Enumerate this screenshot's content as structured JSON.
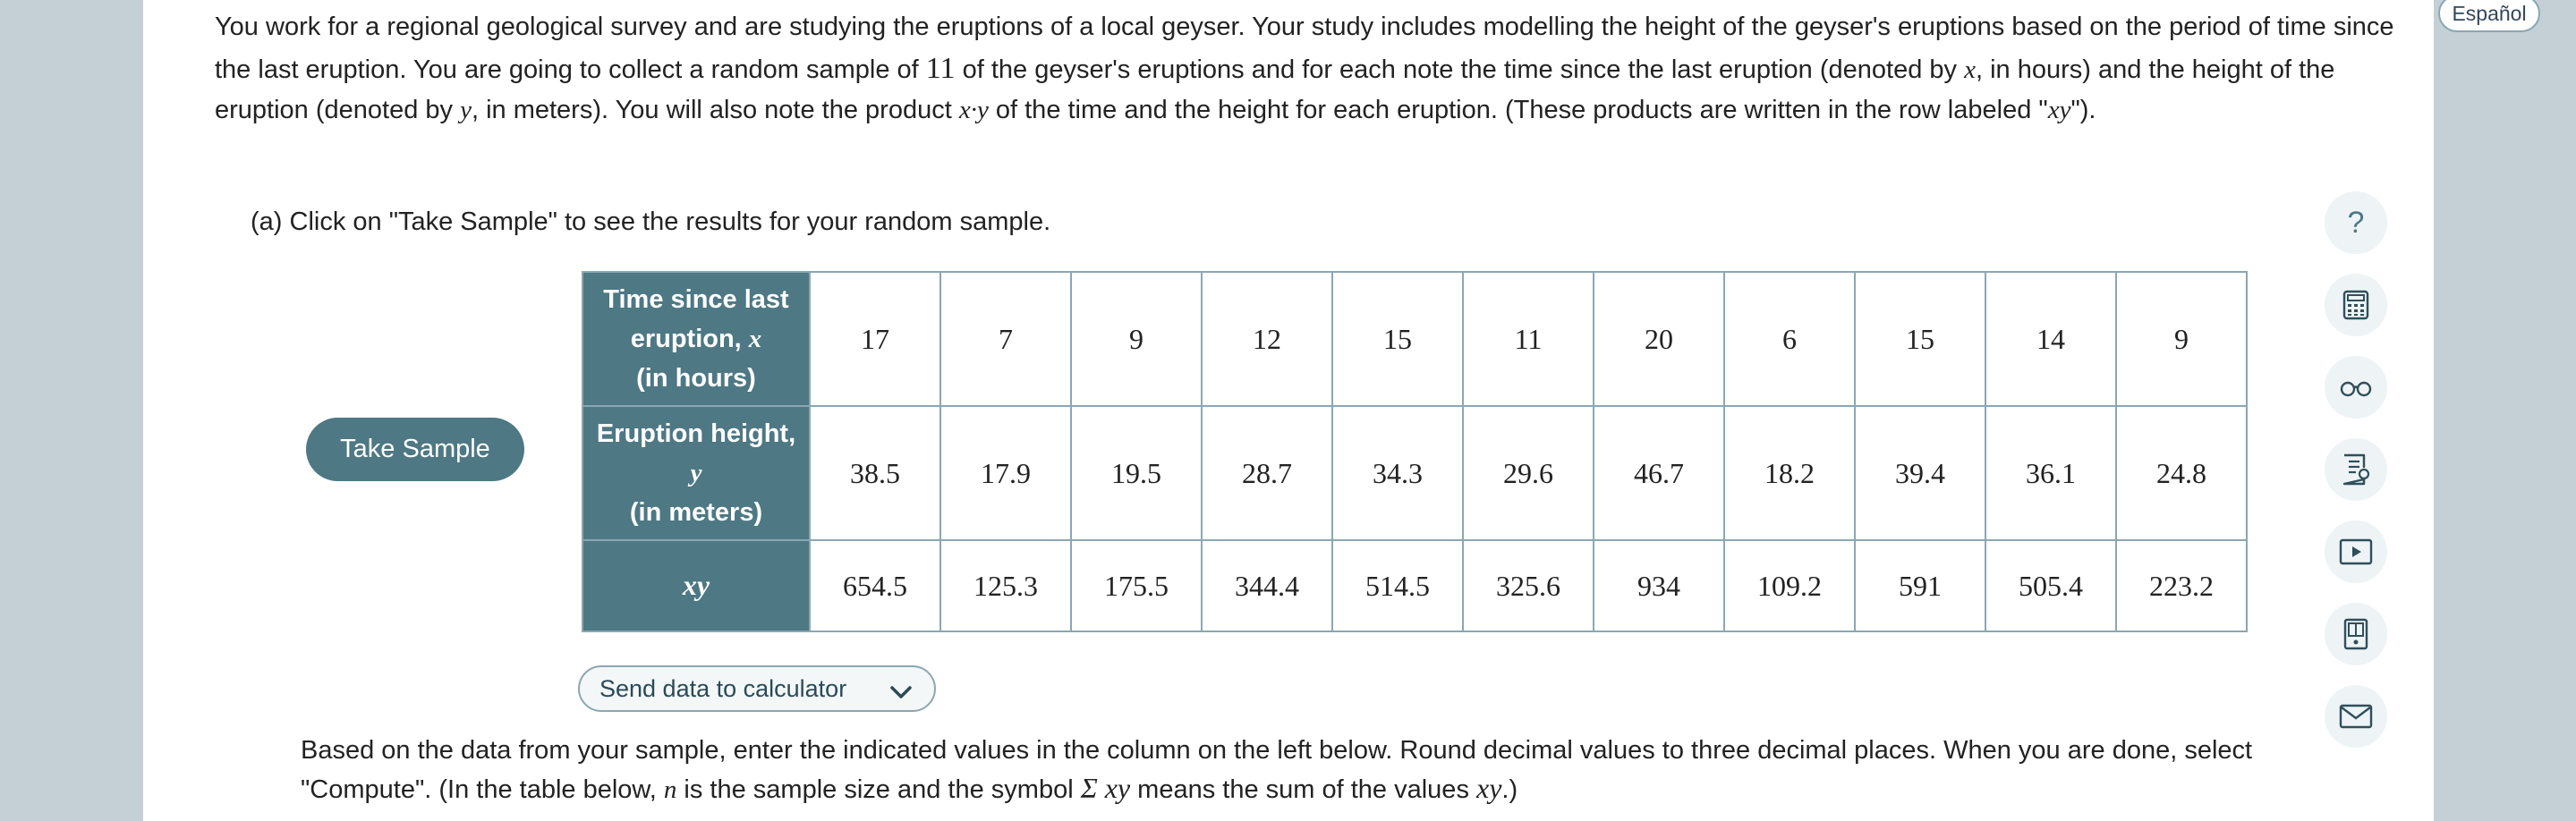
{
  "language_button": "Español",
  "intro": {
    "s1": "You work for a regional geological survey and are studying the eruptions of a local geyser. Your study includes modelling the height of the geyser's eruptions based on the period of time since the last eruption. You are going to collect a random sample of ",
    "n": "11",
    "s2": " of the geyser's eruptions and for each note the time since the last eruption (denoted by ",
    "x": "x",
    "s3": ", in hours) and the height of the eruption (denoted by ",
    "y": "y",
    "s4": ", in meters). You will also note the product ",
    "xy_prod": "x·y",
    "s5": " of the time and the height for each eruption. (These products are written in the row labeled \"",
    "xy": "xy",
    "s6": "\")."
  },
  "part_a": "(a) Click on \"Take Sample\" to see the results for your random sample.",
  "take_sample_label": "Take Sample",
  "table": {
    "row1": {
      "label_pre": "Time since last eruption, ",
      "var": "x",
      "label_post": "(in hours)"
    },
    "row2": {
      "label_pre": "Eruption height, ",
      "var": "y",
      "label_post": "(in meters)"
    },
    "row3": {
      "var": "xy"
    },
    "x": [
      "17",
      "7",
      "9",
      "12",
      "15",
      "11",
      "20",
      "6",
      "15",
      "14",
      "9"
    ],
    "y": [
      "38.5",
      "17.9",
      "19.5",
      "28.7",
      "34.3",
      "29.6",
      "46.7",
      "18.2",
      "39.4",
      "36.1",
      "24.8"
    ],
    "xy": [
      "654.5",
      "125.3",
      "175.5",
      "344.4",
      "514.5",
      "325.6",
      "934",
      "109.2",
      "591",
      "505.4",
      "223.2"
    ]
  },
  "send_data_label": "Send data to calculator",
  "bottom": {
    "s1": "Based on the data from your sample, enter the indicated values in the column on the left below. Round decimal values to three decimal places. When you are done, select \"Compute\". (In the table below, ",
    "n": "n",
    "s2": " is the sample size and the symbol ",
    "sum": "Σ xy",
    "s3": " means the sum of the values ",
    "xy": "xy",
    "s4": ".)"
  },
  "sidebar_icons": [
    "help-icon",
    "calculator-icon",
    "glasses-icon",
    "notes-icon",
    "video-icon",
    "textbook-icon",
    "mail-icon"
  ],
  "colors": {
    "header_bg": "#4d7884",
    "border": "#8aa7b3",
    "page_bg": "#c5d0d6"
  }
}
